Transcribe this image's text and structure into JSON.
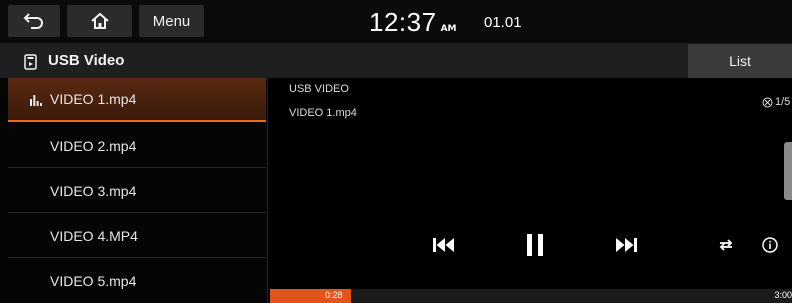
{
  "topbar": {
    "back_icon": "back-arrow-icon",
    "home_icon": "home-icon",
    "menu_label": "Menu",
    "time": "12:37",
    "ampm": "AM",
    "date": "01.01"
  },
  "titlebar": {
    "source_icon": "usb-icon",
    "title": "USB Video",
    "list_label": "List"
  },
  "files": [
    {
      "label": "VIDEO 1.mp4",
      "active": true
    },
    {
      "label": "VIDEO 2.mp4",
      "active": false
    },
    {
      "label": "VIDEO 3.mp4",
      "active": false
    },
    {
      "label": "VIDEO 4.MP4",
      "active": false
    },
    {
      "label": "VIDEO 5.mp4",
      "active": false
    }
  ],
  "player": {
    "source_label": "USB VIDEO",
    "file_label": "VIDEO 1.mp4",
    "counter": "1/5",
    "controls": [
      "previous-icon",
      "pause-icon",
      "next-icon",
      "repeat-icon",
      "info-icon"
    ]
  },
  "progress": {
    "current_time": "0:28",
    "total_time": "3:00",
    "fraction": 0.155
  },
  "colors": {
    "accent": "#e3541c",
    "active_item": "#5b2a12",
    "button_bg": "#2b2b2b"
  }
}
